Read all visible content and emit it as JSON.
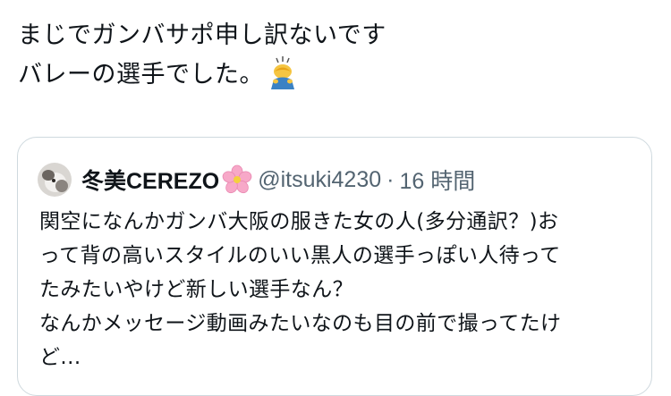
{
  "tweet": {
    "lines": [
      "まじでガンバサポ申し訳ないです",
      "バレーの選手でした。"
    ],
    "emoji": "person-bowing-emoji"
  },
  "quote": {
    "display_name": "冬美CEREZO",
    "name_emoji": "cherry-blossom-icon",
    "handle": "@itsuki4230",
    "separator": "·",
    "timestamp": "16 時間",
    "body_lines": [
      "関空になんかガンバ大阪の服きた女の人(多分通訳？)お",
      "って背の高いスタイルのいい黒人の選手っぽい人待って",
      "たみたいやけど新しい選手なん？",
      "なんかメッセージ動画みたいなのも目の前で撮ってたけ",
      "ど..."
    ]
  },
  "colors": {
    "text": "#0f1419",
    "secondary": "#536471",
    "border": "#cfd9de"
  }
}
